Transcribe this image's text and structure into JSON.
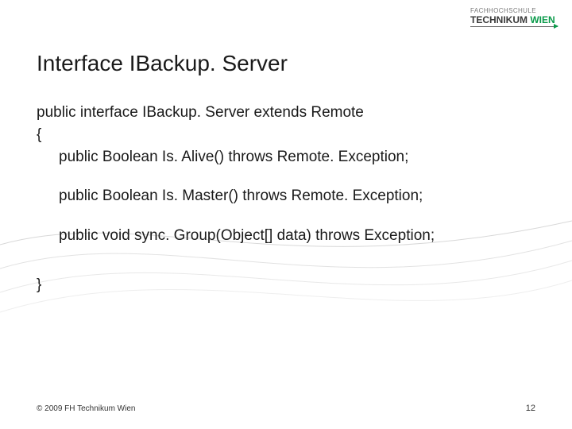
{
  "logo": {
    "line1": "FACHHOCHSCHULE",
    "line2_a": "TECHNIKUM",
    "line2_b": "WIEN"
  },
  "title": "Interface IBackup. Server",
  "code": {
    "l1": "public interface IBackup. Server  extends Remote",
    "l2": "{",
    "l3": "public Boolean Is. Alive() throws Remote. Exception;",
    "l4": "public Boolean Is. Master() throws Remote. Exception;",
    "l5": "public void sync. Group(Object[] data) throws Exception;",
    "l6": "}"
  },
  "footer": {
    "copyright": "© 2009 FH Technikum Wien",
    "page": "12"
  }
}
